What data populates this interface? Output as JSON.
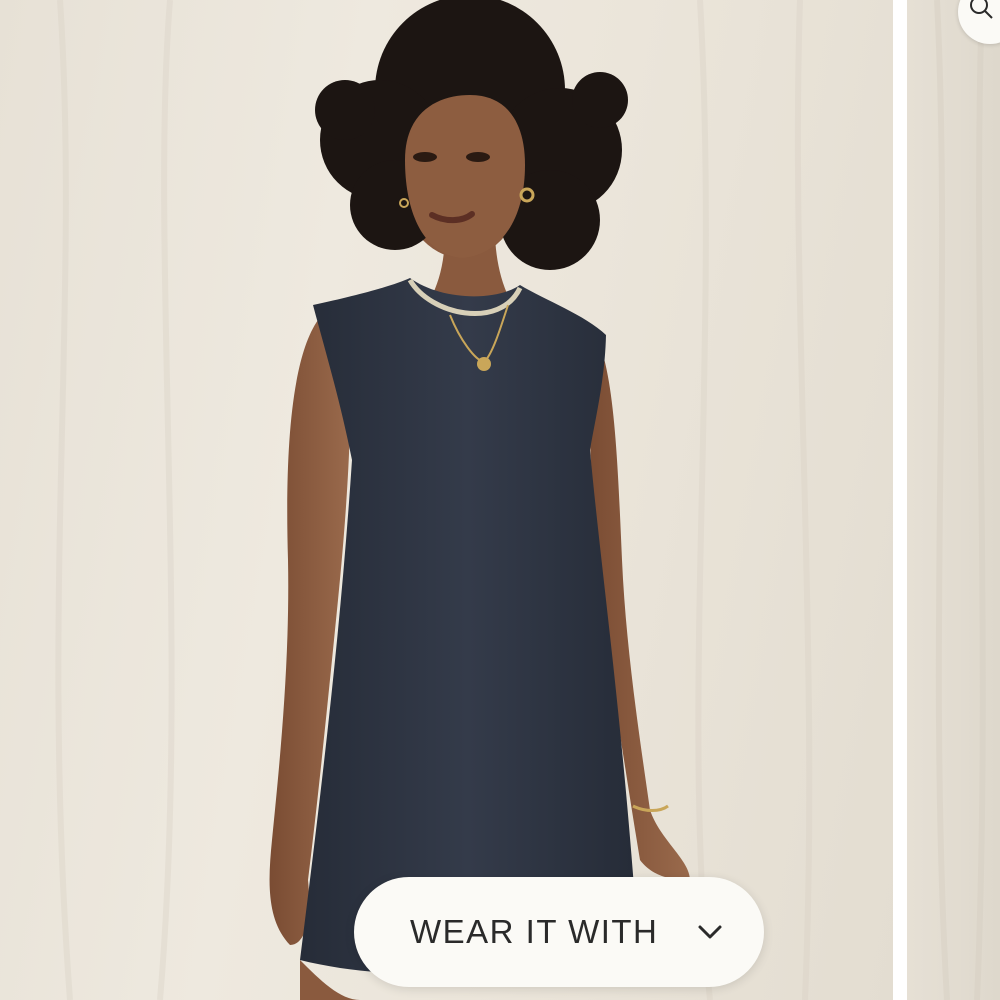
{
  "product_gallery": {
    "main_image": "product-photo-model-sleeveless-navy-dress",
    "next_image": "product-photo-peek"
  },
  "wear_it_with": {
    "label": "WEAR IT WITH",
    "icon": "chevron-down-icon"
  },
  "zoom": {
    "icon": "zoom-icon"
  },
  "colors": {
    "backdrop": "#ebe5da",
    "dress": "#2f3645",
    "skin": "#8a5a3e",
    "pill_bg": "#fbfaf6",
    "pill_text": "#2a2a2a"
  }
}
